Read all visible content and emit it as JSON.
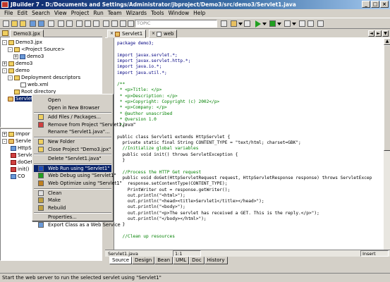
{
  "window": {
    "title": "JBuilder 7 - D:/Documents and Settings/Administrator/jbproject/Demo3/src/demo3/Servlet1.java"
  },
  "menu": [
    "File",
    "Edit",
    "Search",
    "View",
    "Project",
    "Run",
    "Team",
    "Wizards",
    "Tools",
    "Window",
    "Help"
  ],
  "toolbar": {
    "topic_placeholder": "TOPIC"
  },
  "project": {
    "tab_label": "Demo3.jpx",
    "tree": [
      {
        "label": "Demo3.jpx"
      },
      {
        "label": "<Project Source>"
      },
      {
        "label": "demo3"
      },
      {
        "label": "demo3"
      },
      {
        "label": "demo"
      },
      {
        "label": "Deployment descriptors"
      },
      {
        "label": "web.xml"
      },
      {
        "label": "Root directory"
      },
      {
        "label": "Servlet1.java"
      }
    ]
  },
  "structure": {
    "rows": [
      "Impor",
      "Servle",
      "HttpS",
      "Servle",
      "doGet",
      "init()",
      "CO"
    ]
  },
  "editor": {
    "tabs": [
      "Servlet1",
      "web"
    ],
    "lines": [
      "package demo3;",
      "",
      "import javax.servlet.*;",
      "import javax.servlet.http.*;",
      "import java.io.*;",
      "import java.util.*;",
      "",
      "/**",
      " * <p>Title: </p>",
      " * <p>Description: </p>",
      " * <p>Copyright: Copyright (c) 2002</p>",
      " * <p>Company: </p>",
      " * @author unascribed",
      " * @version 1.0",
      " */",
      "",
      "public class Servlet1 extends HttpServlet {",
      "  private static final String CONTENT_TYPE = \"text/html; charset=GBK\";",
      "  //Initialize global variables",
      "  public void init() throws ServletException {",
      "  }",
      "",
      "  //Process the HTTP Get request",
      "  public void doGet(HttpServletRequest request, HttpServletResponse response) throws ServletExcep",
      "    response.setContentType(CONTENT_TYPE);",
      "    PrintWriter out = response.getWriter();",
      "    out.println(\"<html>\");",
      "    out.println(\"<head><title>Servlet1</title></head>\");",
      "    out.println(\"<body>\");",
      "    out.println(\"<p>The servlet has received a GET. This is the reply.</p>\");",
      "    out.println(\"</body></html>\");",
      "  }",
      "",
      "  //Clean up resources"
    ],
    "file_label": "Servlet1.java",
    "position": "1:1",
    "insert_mode": "Insert",
    "bottom_tabs": [
      "Source",
      "Design",
      "Bean",
      "UML",
      "Doc",
      "History"
    ]
  },
  "context_menu": {
    "items": [
      "Open",
      "Open in New Browser",
      "Add Files / Packages...",
      "Remove from Project \"Servlet1.java\"",
      "Rename \"Servlet1.java\"...",
      "New Folder",
      "Close Project \"Demo3.jpx\"",
      "Delete \"Servlet1.java\"",
      "Web Run using \"Servlet1\"",
      "Web Debug using \"Servlet1\"",
      "Web Optimize using \"Servlet1\"",
      "Clean",
      "Make",
      "Rebuild",
      "Properties...",
      "Export Class as a Web Service"
    ],
    "highlighted": "Web Run using \"Servlet1\""
  },
  "status": {
    "text": "Start the web server to run the selected servlet using \"Servlet1\""
  }
}
